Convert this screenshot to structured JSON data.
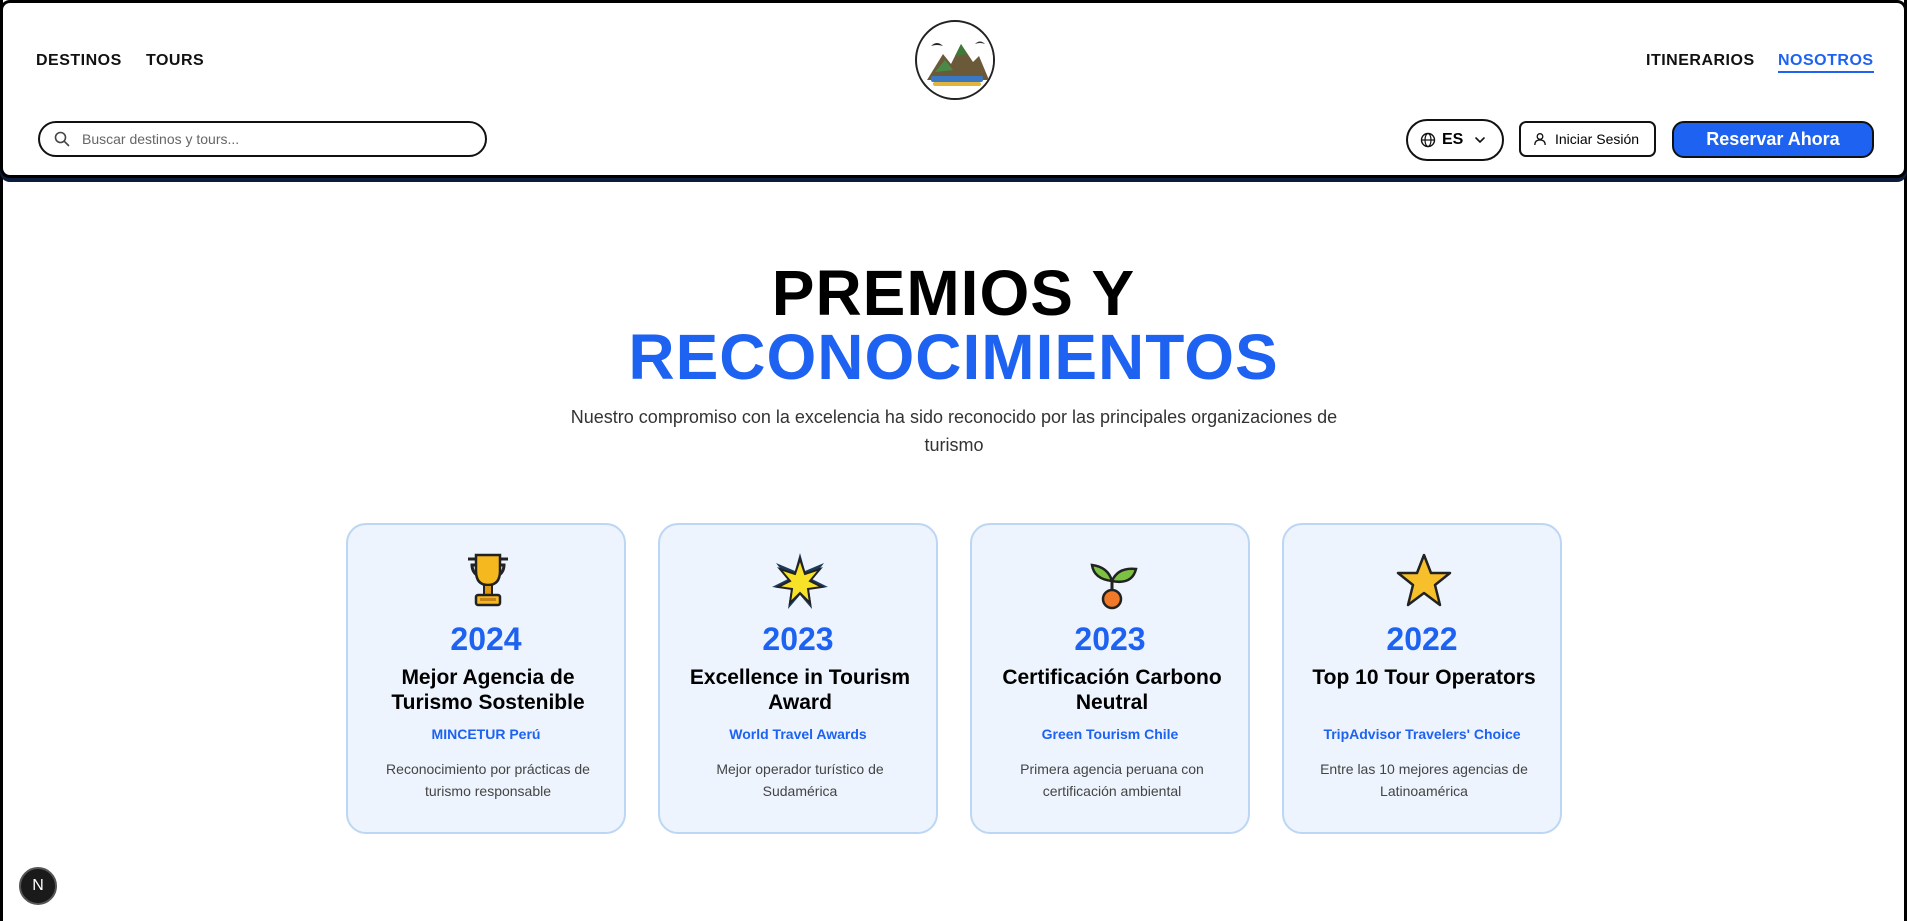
{
  "nav": {
    "left": [
      "DESTINOS",
      "TOURS"
    ],
    "right": [
      "ITINERARIOS",
      "NOSOTROS"
    ],
    "active": "NOSOTROS"
  },
  "search": {
    "placeholder": "Buscar destinos y tours..."
  },
  "language": {
    "value": "ES"
  },
  "login_label": "Iniciar Sesión",
  "reserve_label": "Reservar Ahora",
  "hero": {
    "title_line1": "PREMIOS Y",
    "title_line2": "RECONOCIMIENTOS",
    "subtitle": "Nuestro compromiso con la excelencia ha sido reconocido por las principales organizaciones de turismo"
  },
  "awards": [
    {
      "icon": "trophy-icon",
      "year": "2024",
      "name": "Mejor Agencia de Turismo Sostenible",
      "org": "MINCETUR Perú",
      "desc": "Reconocimiento por prácticas de turismo responsable"
    },
    {
      "icon": "glowing-star-icon",
      "year": "2023",
      "name": "Excellence in Tourism Award",
      "org": "World Travel Awards",
      "desc": "Mejor operador turístico de Sudamérica"
    },
    {
      "icon": "seedling-icon",
      "year": "2023",
      "name": "Certificación Carbono Neutral",
      "org": "Green Tourism Chile",
      "desc": "Primera agencia peruana con certificación ambiental"
    },
    {
      "icon": "star-icon",
      "year": "2022",
      "name": "Top 10 Tour Operators",
      "org": "TripAdvisor Travelers' Choice",
      "desc": "Entre las 10 mejores agencias de Latinoamérica"
    }
  ],
  "badge_letter": "N",
  "colors": {
    "accent": "#1d62f0",
    "card_bg": "#edf4fd",
    "card_border": "#bcd6f3"
  }
}
